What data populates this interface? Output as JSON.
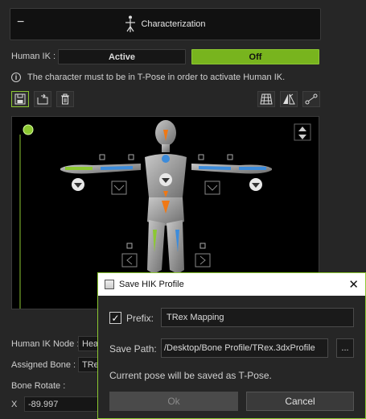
{
  "header": {
    "title": "Characterization",
    "collapse": "−"
  },
  "human_ik": {
    "label": "Human IK :",
    "active_label": "Active",
    "off_label": "Off"
  },
  "info": {
    "icon": "i",
    "text": "The character must to be in T-Pose in order to activate Human IK."
  },
  "toolbar": {
    "left": [
      "save-icon",
      "load-icon",
      "delete-icon"
    ],
    "right": [
      "grid-icon",
      "mirror-icon",
      "bone-icon"
    ]
  },
  "form": {
    "human_ik_node_label": "Human IK Node :",
    "human_ik_node_value": "Hea",
    "assigned_bone_label": "Assigned Bone :",
    "assigned_bone_value": "TRe",
    "bone_rotate_label": "Bone Rotate :",
    "x_label": "X",
    "x_value": "-89.997"
  },
  "dialog": {
    "title": "Save HIK Profile",
    "close": "✕",
    "prefix_label": "Prefix:",
    "prefix_value": "TRex Mapping",
    "prefix_checked": "✓",
    "save_path_label": "Save Path:",
    "save_path_value": "/Desktop/Bone Profile/TRex.3dxProfile",
    "browse_label": "...",
    "note": "Current pose will be saved as T-Pose.",
    "ok_label": "Ok",
    "cancel_label": "Cancel"
  },
  "colors": {
    "accent": "#78b41e",
    "orange": "#f07814",
    "blue": "#3c8cdc",
    "green_marker": "#8cc832"
  }
}
